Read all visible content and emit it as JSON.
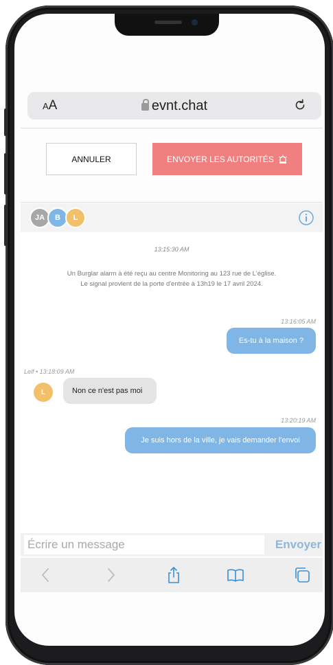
{
  "browser": {
    "text_size_label": "AA",
    "domain": "evnt.chat"
  },
  "actions": {
    "cancel_label": "ANNULER",
    "alert_label": "ENVOYER LES AUTORITÉS"
  },
  "participants": [
    {
      "initials": "JA",
      "color": "#a7a7a7"
    },
    {
      "initials": "B",
      "color": "#7fb6e6"
    },
    {
      "initials": "L",
      "color": "#f2c06b"
    }
  ],
  "chat": {
    "system_time": "13:15:30 AM",
    "system_line1": "Un Burglar alarm à été reçu au centre Monitoring au 123 rue de L'église.",
    "system_line2": "Le signal provient de la porte d'entrée à 13h19 le 17 avril 2024.",
    "messages": [
      {
        "direction": "out",
        "time": "13:16:05 AM",
        "text": "Es-tu à la maison ?"
      },
      {
        "direction": "in",
        "author": "Leif",
        "author_initial": "L",
        "time": "13:18:09 AM",
        "meta": "Leif • 13:18:09 AM",
        "text": "Non ce n'est pas moi"
      },
      {
        "direction": "out",
        "time": "13:20:19 AM",
        "text": "Je suis hors de la ville, je vais demander l'envoi"
      }
    ]
  },
  "composer": {
    "placeholder": "Écrire un message",
    "value": "",
    "send_label": "Envoyer"
  },
  "colors": {
    "accent_blue": "#7fb6e6",
    "alert_red": "#f08080",
    "avatar_yellow": "#f2c06b"
  },
  "toolbar_icons": [
    "back-icon",
    "forward-icon",
    "share-icon",
    "bookmarks-icon",
    "tabs-icon"
  ]
}
